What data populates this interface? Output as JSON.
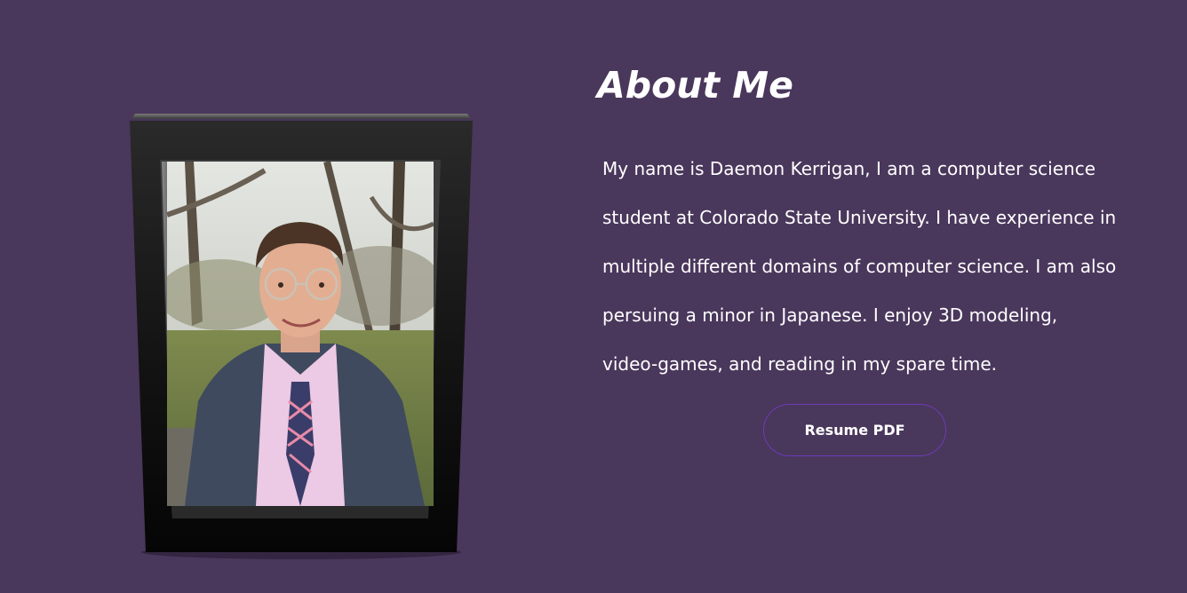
{
  "about": {
    "title": "About Me",
    "paragraph": "My name is Daemon Kerrigan, I am a computer science student at Colorado State University. I have experience in multiple different domains of computer science. I am also persuing a minor in Japanese. I enjoy 3D modeling, video-games, and reading in my spare time.",
    "resume_button_label": "Resume PDF"
  },
  "colors": {
    "background": "#4a375c",
    "frame": "#111111",
    "button_border": "#6d3bb8",
    "text": "#ffffff"
  },
  "icons": {
    "portrait": "portrait-photo"
  }
}
